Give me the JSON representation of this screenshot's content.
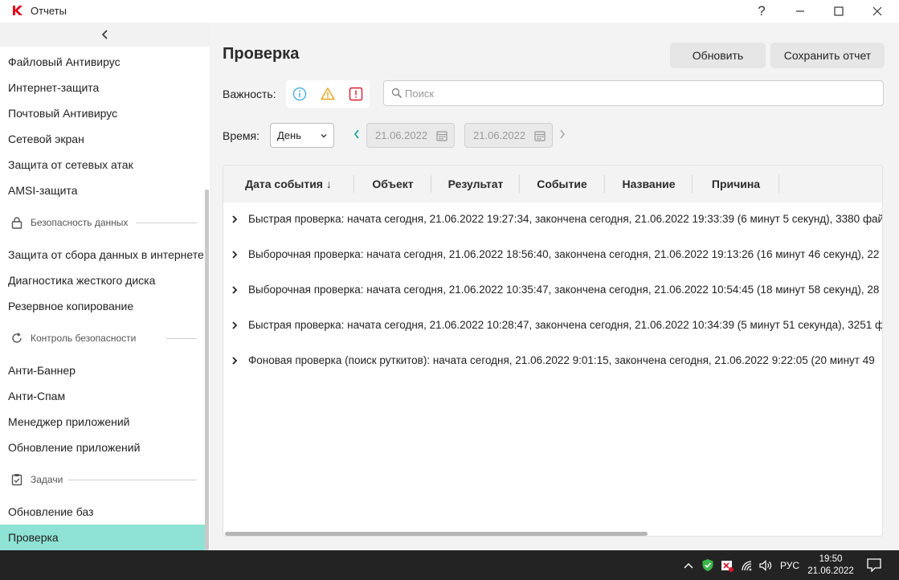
{
  "window": {
    "title": "Отчеты",
    "help": "?"
  },
  "sidebar": {
    "items": [
      {
        "label": "Файловый Антивирус"
      },
      {
        "label": "Интернет-защита"
      },
      {
        "label": "Почтовый Антивирус"
      },
      {
        "label": "Сетевой экран"
      },
      {
        "label": "Защита от сетевых атак"
      },
      {
        "label": "AMSI-защита"
      }
    ],
    "section_data": "Безопасность данных",
    "items_data": [
      {
        "label": "Защита от сбора данных в интернете"
      },
      {
        "label": "Диагностика жесткого диска"
      },
      {
        "label": "Резервное копирование"
      }
    ],
    "section_control": "Контроль безопасности",
    "items_control": [
      {
        "label": "Анти-Баннер"
      },
      {
        "label": "Анти-Спам"
      },
      {
        "label": "Менеджер приложений"
      },
      {
        "label": "Обновление приложений"
      }
    ],
    "section_tasks": "Задачи",
    "items_tasks": [
      {
        "label": "Обновление баз"
      },
      {
        "label": "Проверка"
      }
    ],
    "active_color": "#8ee3d4"
  },
  "main": {
    "title": "Проверка",
    "refresh_button": "Обновить",
    "save_button": "Сохранить отчет",
    "severity_label": "Важность:",
    "search_placeholder": "Поиск",
    "time_label": "Время:",
    "period": "День",
    "date_from": "21.06.2022",
    "date_to": "21.06.2022",
    "columns": [
      "Дата события",
      "Объект",
      "Результат",
      "Событие",
      "Название",
      "Причина"
    ],
    "sort_indicator": "↓",
    "rows": [
      "Быстрая проверка: начата сегодня, 21.06.2022 19:27:34, закончена сегодня, 21.06.2022 19:33:39 (6 минут 5 секунд), 3380 фай",
      "Выборочная проверка: начата сегодня, 21.06.2022 18:56:40, закончена сегодня, 21.06.2022 19:13:26 (16 минут 46 секунд), 22",
      "Выборочная проверка: начата сегодня, 21.06.2022 10:35:47, закончена сегодня, 21.06.2022 10:54:45 (18 минут 58 секунд), 28",
      "Быстрая проверка: начата сегодня, 21.06.2022 10:28:47, закончена сегодня, 21.06.2022 10:34:39 (5 минут 51 секунда), 3251 ф",
      "Фоновая проверка (поиск руткитов): начата сегодня, 21.06.2022 9:01:15, закончена сегодня, 21.06.2022 9:22:05 (20 минут 49"
    ]
  },
  "taskbar": {
    "language": "РУС",
    "time": "19:50",
    "date": "21.06.2022"
  }
}
